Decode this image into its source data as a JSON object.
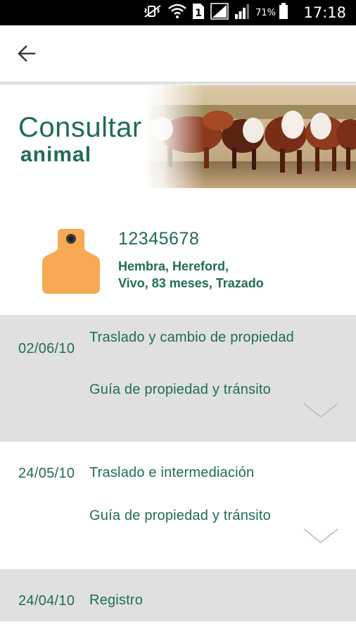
{
  "status_bar": {
    "battery_percent": "71%",
    "time": "17:18",
    "sim_slot": "1",
    "icons": [
      "mute-vibrate-icon",
      "wifi-icon",
      "sim-1-icon",
      "signal-icon",
      "signal-icon",
      "battery-icon"
    ]
  },
  "app_bar": {
    "back_icon": "arrow-left-icon"
  },
  "banner": {
    "title_line1": "Consultar",
    "title_line2": "animal",
    "image": "hereford-cattle-photo"
  },
  "animal": {
    "id": "12345678",
    "line1": "Hembra, Hereford,",
    "line2": "Vivo, 83 meses, Trazado",
    "tag_icon": "ear-tag-icon",
    "tag_color": "#f7a954"
  },
  "events": [
    {
      "date": "02/06/10",
      "type": "Traslado y cambio de propiedad",
      "document": "Guía de propiedad y tránsito",
      "expand_icon": "chevron-down-icon"
    },
    {
      "date": "24/05/10",
      "type": "Traslado e intermediación",
      "document": "Guía de propiedad y tránsito",
      "expand_icon": "chevron-down-icon"
    },
    {
      "date": "24/04/10",
      "type": "Registro"
    }
  ],
  "colors": {
    "accent": "#1f6e4e",
    "row_gray": "#e0e0e0",
    "status_bar": "#000000"
  }
}
